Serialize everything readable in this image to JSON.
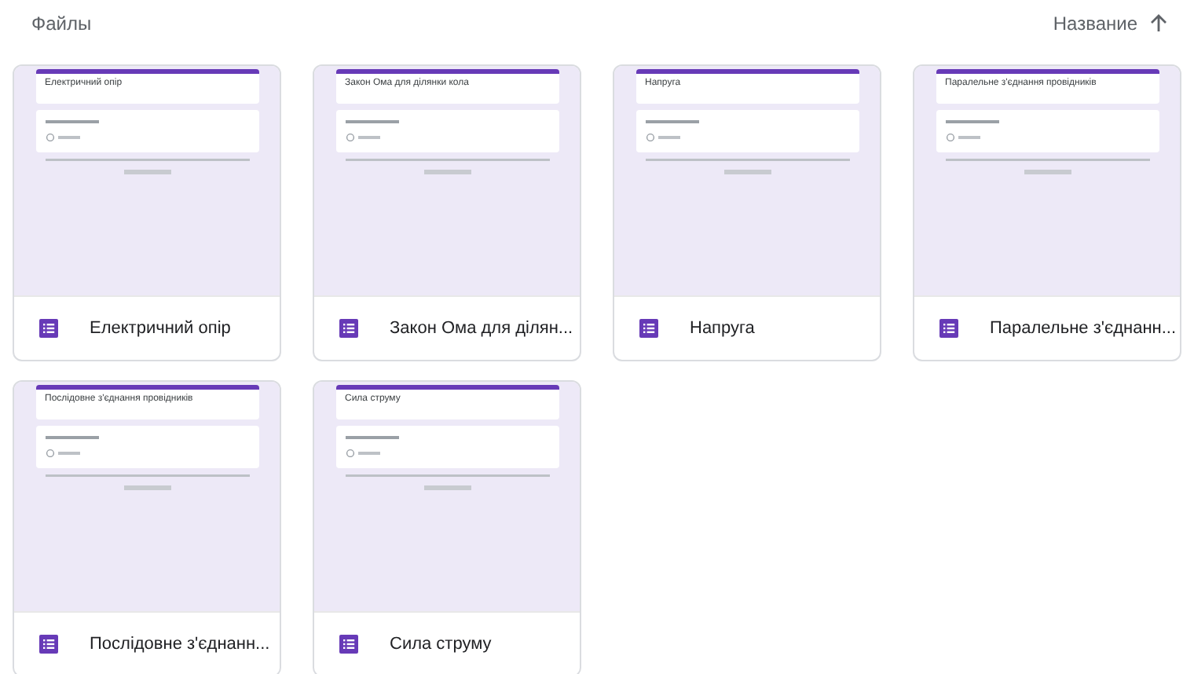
{
  "header": {
    "title": "Файлы",
    "sort_label": "Название"
  },
  "files": [
    {
      "thumbnail_title": "Електричний опір",
      "name": "Електричний опір"
    },
    {
      "thumbnail_title": "Закон Ома для ділянки кола",
      "name": "Закон Ома для ділян..."
    },
    {
      "thumbnail_title": "Напруга",
      "name": "Напруга"
    },
    {
      "thumbnail_title": "Паралельне з'єднання провідників",
      "name": "Паралельне з'єднанн..."
    },
    {
      "thumbnail_title": "Послідовне з'єднання провідників",
      "name": "Послідовне з'єднанн..."
    },
    {
      "thumbnail_title": "Сила струму",
      "name": "Сила струму"
    }
  ]
}
